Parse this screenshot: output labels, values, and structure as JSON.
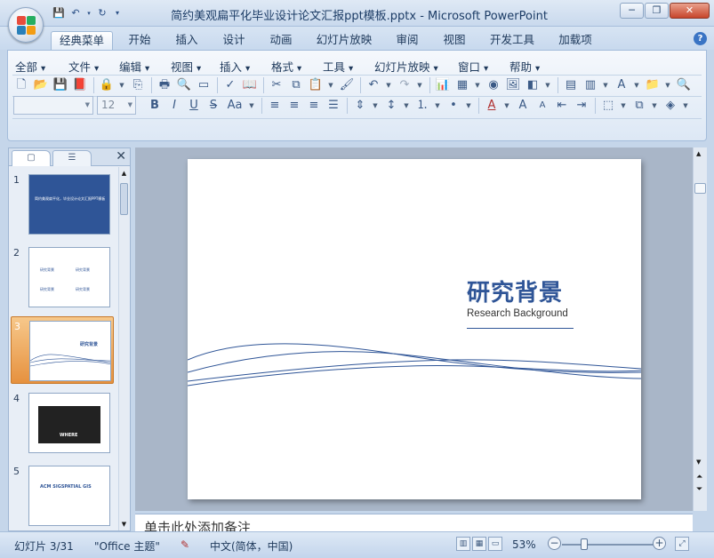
{
  "window": {
    "title": "简约美观扁平化毕业设计论文汇报ppt模板.pptx - Microsoft PowerPoint",
    "minimize_icon": "minimize-icon",
    "maximize_icon": "restore-icon",
    "close_icon": "close-icon"
  },
  "quick_access": [
    "save-icon",
    "undo-icon",
    "undo-dropdown-icon",
    "redo-icon",
    "customize-icon"
  ],
  "tabs": [
    {
      "label": "经典菜单",
      "active": true
    },
    {
      "label": "开始"
    },
    {
      "label": "插入"
    },
    {
      "label": "设计"
    },
    {
      "label": "动画"
    },
    {
      "label": "幻灯片放映"
    },
    {
      "label": "审阅"
    },
    {
      "label": "视图"
    },
    {
      "label": "开发工具"
    },
    {
      "label": "加载项"
    }
  ],
  "menus": [
    "全部",
    "文件",
    "编辑",
    "视图",
    "插入",
    "格式",
    "工具",
    "幻灯片放映",
    "窗口",
    "帮助"
  ],
  "font": {
    "name_value": "",
    "size_value": "12"
  },
  "thumbnails": [
    {
      "num": "1",
      "title": "简约美观扁平化，毕业设计论文汇报PPT模板"
    },
    {
      "num": "2",
      "title": "研究背景"
    },
    {
      "num": "3",
      "title": "研究背景",
      "selected": true
    },
    {
      "num": "4",
      "title": "WHERE"
    },
    {
      "num": "5",
      "title": "ACM SIGSPATIAL GIS"
    }
  ],
  "slide": {
    "title": "研究背景",
    "subtitle": "Research Background"
  },
  "notes": {
    "placeholder": "单击此处添加备注"
  },
  "status": {
    "slide_info": "幻灯片 3/31",
    "theme": "\"Office 主题\"",
    "language": "中文(简体，中国)",
    "zoom": "53%",
    "zoom_fraction": 0.53
  },
  "colors": {
    "accent": "#2f5597",
    "selection": "#e6913e"
  }
}
